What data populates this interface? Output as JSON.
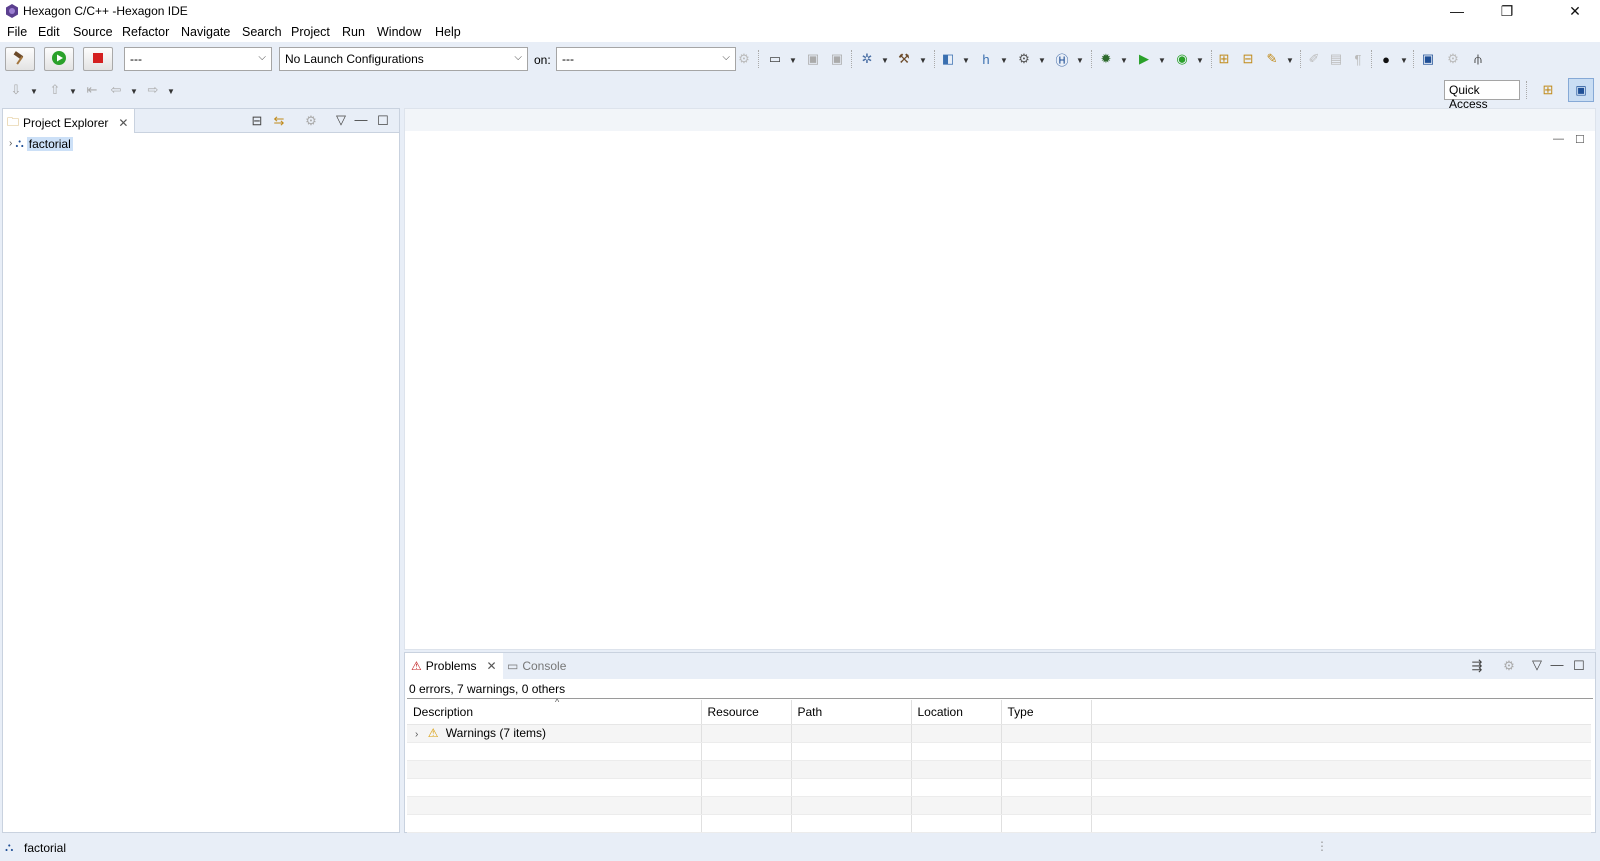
{
  "window": {
    "title": "Hexagon C/C++ -Hexagon IDE",
    "minimize": "—",
    "restore": "❐",
    "close": "✕"
  },
  "menubar": [
    "File",
    "Edit",
    "Source",
    "Refactor",
    "Navigate",
    "Search",
    "Project",
    "Run",
    "Window",
    "Help"
  ],
  "toolbar": {
    "mode_combo": "---",
    "launch_combo": "No Launch Configurations",
    "on_label": "on:",
    "target_combo": "---",
    "quick_access": "Quick Access"
  },
  "project_explorer": {
    "tab_label": "Project Explorer",
    "items": [
      {
        "label": "factorial"
      }
    ]
  },
  "problems_view": {
    "tabs": [
      {
        "label": "Problems"
      },
      {
        "label": "Console"
      }
    ],
    "summary": "0 errors, 7 warnings, 0 others",
    "columns": [
      "Description",
      "Resource",
      "Path",
      "Location",
      "Type"
    ],
    "rows": [
      {
        "description": "Warnings (7 items)"
      }
    ]
  },
  "statusbar": {
    "selection": "factorial"
  }
}
